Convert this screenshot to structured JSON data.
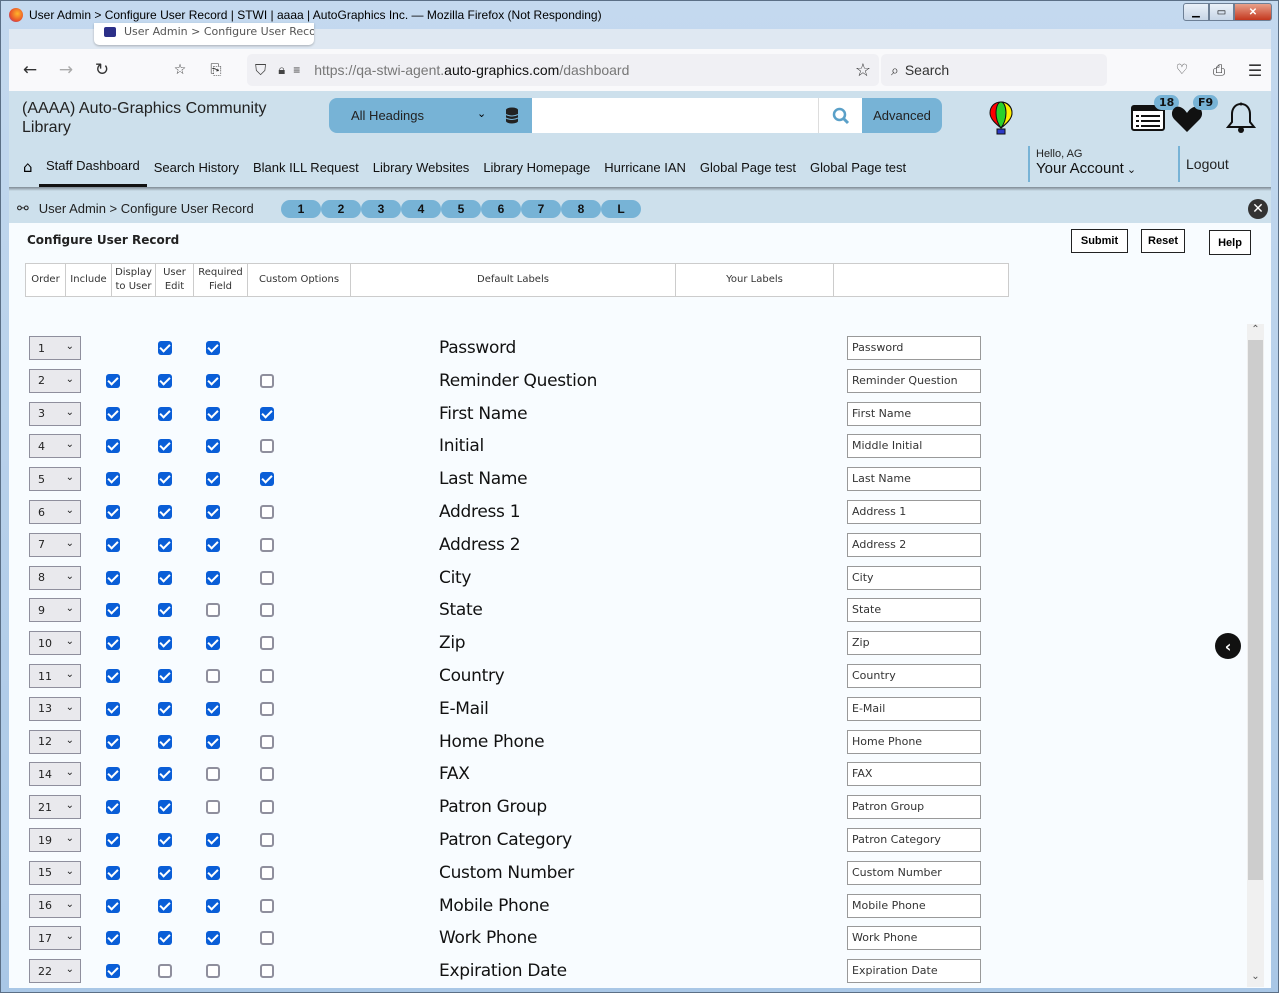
{
  "window": {
    "title": "User Admin > Configure User Record | STWI | aaaa | AutoGraphics Inc. — Mozilla Firefox (Not Responding)",
    "tab_title": "User Admin > Configure User Record",
    "url_prefix": "https://qa-stwi-agent.",
    "url_domain": "auto-graphics.com",
    "url_path": "/dashboard",
    "search_placeholder": "Search"
  },
  "header": {
    "library_name": "(AAAA) Auto-Graphics Community Library",
    "search_scope": "All Headings",
    "search_value": "",
    "advanced_label": "Advanced",
    "list_badge": "18",
    "fav_badge": "F9",
    "hello": "Hello, AG",
    "account_label": "Your Account",
    "logout_label": "Logout"
  },
  "menu": [
    {
      "label": "Staff Dashboard",
      "active": true
    },
    {
      "label": "Search History"
    },
    {
      "label": "Blank ILL Request"
    },
    {
      "label": "Library Websites"
    },
    {
      "label": "Library Homepage"
    },
    {
      "label": "Hurricane IAN"
    },
    {
      "label": "Global Page test"
    },
    {
      "label": "Global Page test"
    }
  ],
  "breadcrumb": "User Admin > Configure User Record",
  "pills": [
    "1",
    "2",
    "3",
    "4",
    "5",
    "6",
    "7",
    "8",
    "L"
  ],
  "page": {
    "title": "Configure User Record",
    "submit": "Submit",
    "reset": "Reset",
    "help": "Help",
    "columns": {
      "order": "Order",
      "include": "Include",
      "display_1": "Display",
      "display_2": "to User",
      "edit_1": "User",
      "edit_2": "Edit",
      "req_1": "Required",
      "req_2": "Field",
      "custom": "Custom Options",
      "default": "Default Labels",
      "yours": "Your Labels"
    }
  },
  "rows": [
    {
      "order": "1",
      "include": null,
      "display": true,
      "edit": true,
      "required": null,
      "label": "Password",
      "your_label": "Password"
    },
    {
      "order": "2",
      "include": true,
      "display": true,
      "edit": true,
      "required": false,
      "label": "Reminder Question",
      "your_label": "Reminder Question"
    },
    {
      "order": "3",
      "include": true,
      "display": true,
      "edit": true,
      "required": true,
      "label": "First Name",
      "your_label": "First Name"
    },
    {
      "order": "4",
      "include": true,
      "display": true,
      "edit": true,
      "required": false,
      "label": "Initial",
      "your_label": "Middle Initial"
    },
    {
      "order": "5",
      "include": true,
      "display": true,
      "edit": true,
      "required": true,
      "label": "Last Name",
      "your_label": "Last Name"
    },
    {
      "order": "6",
      "include": true,
      "display": true,
      "edit": true,
      "required": false,
      "label": "Address 1",
      "your_label": "Address 1"
    },
    {
      "order": "7",
      "include": true,
      "display": true,
      "edit": true,
      "required": false,
      "label": "Address 2",
      "your_label": "Address 2"
    },
    {
      "order": "8",
      "include": true,
      "display": true,
      "edit": true,
      "required": false,
      "label": "City",
      "your_label": "City"
    },
    {
      "order": "9",
      "include": true,
      "display": true,
      "edit": false,
      "required": false,
      "label": "State",
      "your_label": "State"
    },
    {
      "order": "10",
      "include": true,
      "display": true,
      "edit": true,
      "required": false,
      "label": "Zip",
      "your_label": "Zip"
    },
    {
      "order": "11",
      "include": true,
      "display": true,
      "edit": false,
      "required": false,
      "label": "Country",
      "your_label": "Country"
    },
    {
      "order": "13",
      "include": true,
      "display": true,
      "edit": true,
      "required": false,
      "label": "E-Mail",
      "your_label": "E-Mail"
    },
    {
      "order": "12",
      "include": true,
      "display": true,
      "edit": true,
      "required": false,
      "label": "Home Phone",
      "your_label": "Home Phone"
    },
    {
      "order": "14",
      "include": true,
      "display": true,
      "edit": false,
      "required": false,
      "label": "FAX",
      "your_label": "FAX"
    },
    {
      "order": "21",
      "include": true,
      "display": true,
      "edit": false,
      "required": false,
      "label": "Patron Group",
      "your_label": "Patron Group"
    },
    {
      "order": "19",
      "include": true,
      "display": true,
      "edit": true,
      "required": false,
      "label": "Patron Category",
      "your_label": "Patron Category"
    },
    {
      "order": "15",
      "include": true,
      "display": true,
      "edit": true,
      "required": false,
      "label": "Custom Number",
      "your_label": "Custom Number"
    },
    {
      "order": "16",
      "include": true,
      "display": true,
      "edit": true,
      "required": false,
      "label": "Mobile Phone",
      "your_label": "Mobile Phone"
    },
    {
      "order": "17",
      "include": true,
      "display": true,
      "edit": true,
      "required": false,
      "label": "Work Phone",
      "your_label": "Work Phone"
    },
    {
      "order": "22",
      "include": true,
      "display": false,
      "edit": false,
      "required": false,
      "label": "Expiration Date",
      "your_label": "Expiration Date"
    }
  ],
  "colors": {
    "accent": "#77b3d6",
    "header_bg": "#cde0ec",
    "checkbox": "#0a5ed7"
  }
}
